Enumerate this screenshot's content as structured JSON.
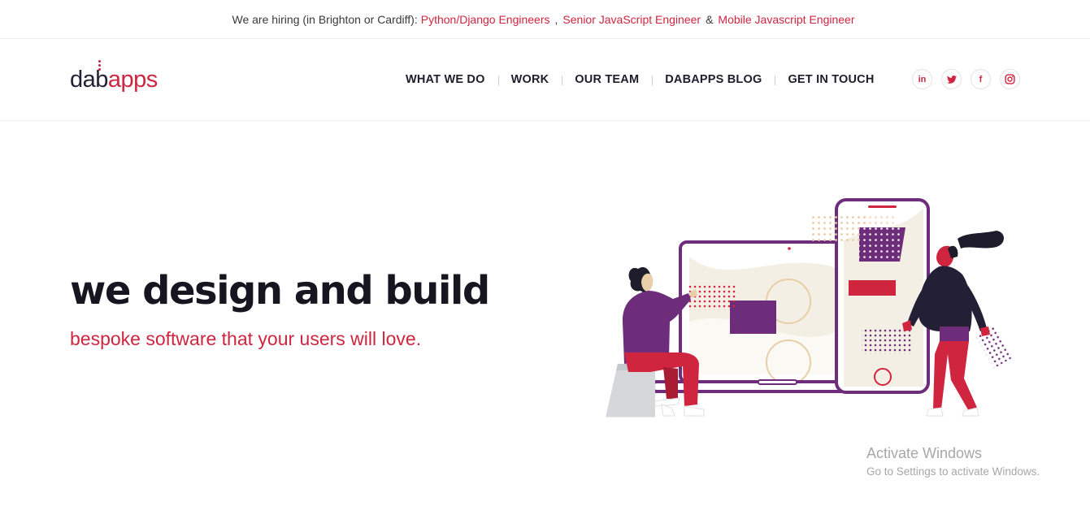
{
  "hiring": {
    "prefix": "We are hiring (in Brighton or Cardiff):",
    "jobs": [
      "Python/Django Engineers",
      "Senior JavaScript Engineer",
      "Mobile Javascript Engineer"
    ],
    "separator_1": ",",
    "separator_2": "&"
  },
  "brand": {
    "logo_part_1": "dab",
    "logo_part_2": "apps"
  },
  "nav": {
    "items": [
      "WHAT WE DO",
      "WORK",
      "OUR TEAM",
      "DABAPPS BLOG",
      "GET IN TOUCH"
    ]
  },
  "social": {
    "icons": [
      "linkedin-icon",
      "twitter-icon",
      "facebook-icon",
      "instagram-icon"
    ],
    "linkedin_text": "in",
    "facebook_text": "f"
  },
  "hero": {
    "title": "we design and build",
    "subtitle": "bespoke software that your users will love."
  },
  "watermark": {
    "line1": "Activate Windows",
    "line2": "Go to Settings to activate Windows."
  },
  "colors": {
    "accent": "#d0253f",
    "dark": "#1f1d2b",
    "purple": "#6e2d7a",
    "cream": "#f3efe4"
  }
}
